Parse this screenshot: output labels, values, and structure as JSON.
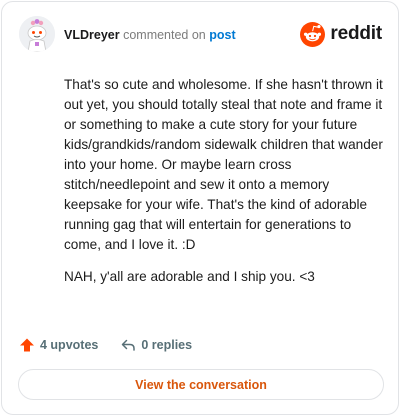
{
  "header": {
    "username": "VLDreyer",
    "action_text": "commented on",
    "target_text": "post",
    "brand_name": "reddit"
  },
  "comment": {
    "paragraphs": [
      "That's so cute and wholesome. If she hasn't thrown it out yet, you should totally steal that note and frame it or something to make a cute story for your future kids/grandkids/random sidewalk children that wander into your home. Or maybe learn cross stitch/needlepoint and sew it onto a memory keepsake for your wife. That's the kind of adorable running gag that will entertain for generations to come, and I love it. :D",
      "NAH, y'all are adorable and I ship you. <3"
    ]
  },
  "footer": {
    "upvotes_label": "4 upvotes",
    "replies_label": "0 replies",
    "view_button_label": "View the conversation"
  },
  "colors": {
    "brand_orange": "#ff4500",
    "link_blue": "#0079d3",
    "cta_text": "#d9560b",
    "muted_text": "#576f76"
  },
  "icons": {
    "avatar": "avatar-snoo",
    "brand": "reddit-logo-icon",
    "upvote": "upvote-arrow-icon",
    "reply": "reply-arrow-icon"
  }
}
